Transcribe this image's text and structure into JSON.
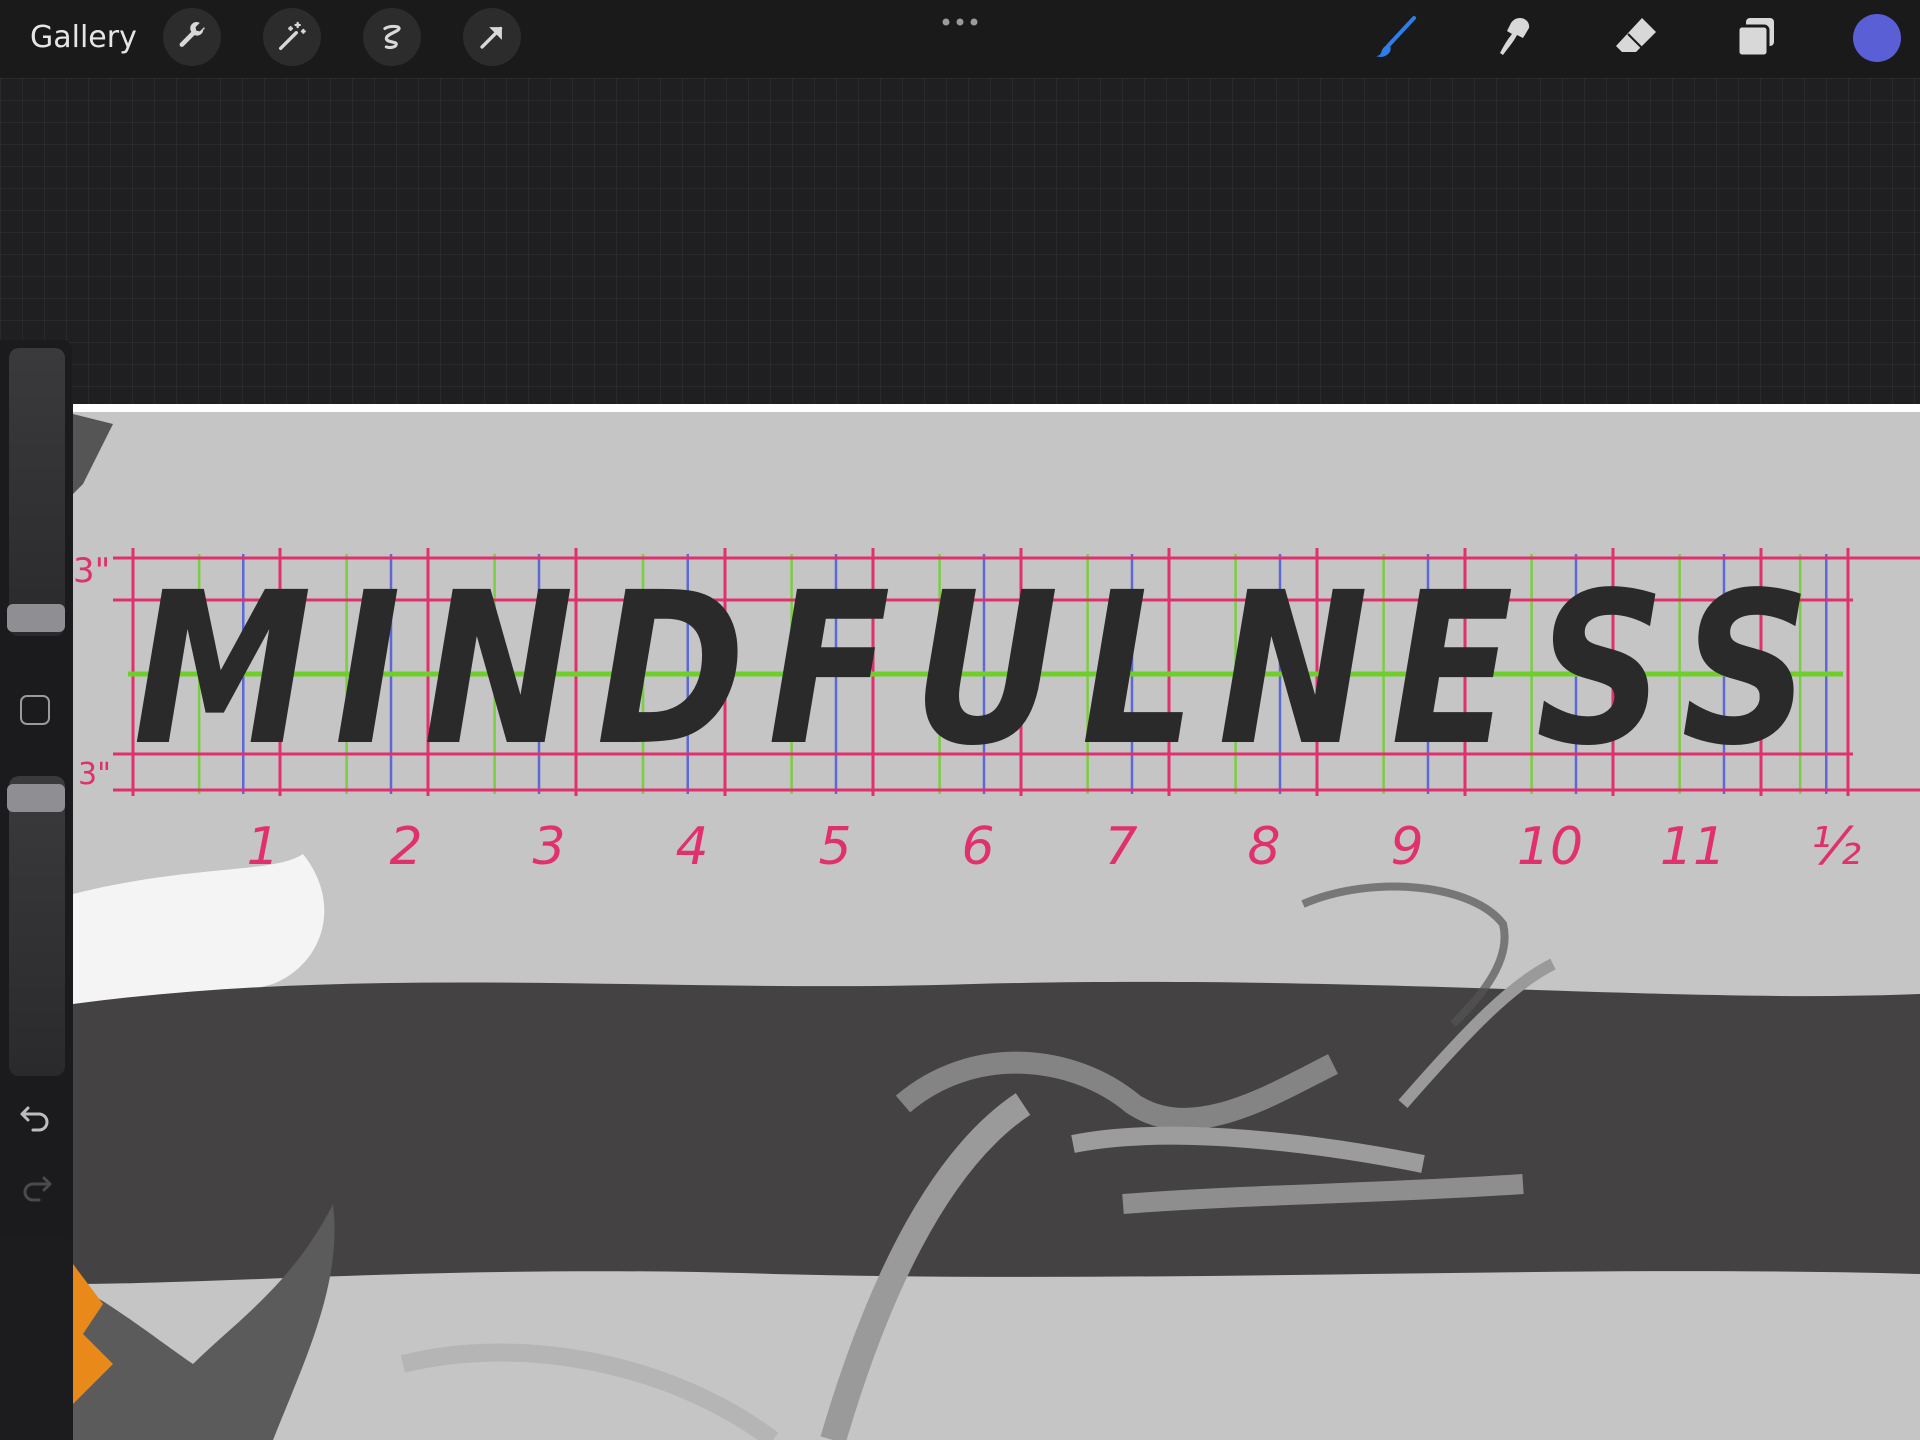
{
  "topbar": {
    "gallery_label": "Gallery",
    "left_tools": [
      "wrench-icon",
      "magic-wand-icon",
      "selection-icon",
      "move-arrow-icon"
    ],
    "more_icon": "ellipsis-icon",
    "right_tools": [
      "brush-icon",
      "smudge-icon",
      "eraser-icon",
      "layers-icon"
    ],
    "active_tool": "brush",
    "current_color": "#5a5fd6"
  },
  "artwork": {
    "word": "MINDFULNESS",
    "left_guide_label": "3\"",
    "left_guide_label_bottom": "3\"",
    "column_numbers": [
      "1",
      "2",
      "3",
      "4",
      "5",
      "6",
      "7",
      "8",
      "9",
      "10",
      "11",
      "½"
    ],
    "guide_colors": {
      "red": "#e0306e",
      "green": "#6fcf2a",
      "blue": "#4a5ad8"
    }
  },
  "sidebar": {
    "icons": [
      "modify-square-icon",
      "undo-icon",
      "redo-icon"
    ]
  }
}
